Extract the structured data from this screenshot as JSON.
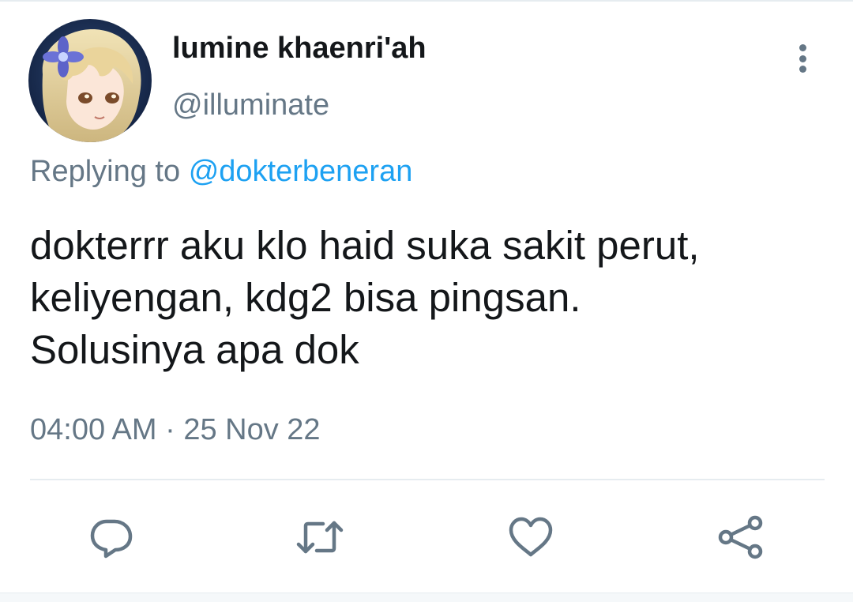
{
  "tweet": {
    "author": {
      "display_name": "lumine khaenri'ah",
      "handle": "@illuminate",
      "avatar_icon": "avatar-image"
    },
    "reply": {
      "prefix": "Replying to",
      "mention": "@dokterbeneran"
    },
    "text_lines": [
      "dokterrr aku klo haid suka sakit perut,",
      "keliyengan, kdg2 bisa pingsan.",
      "Solusinya apa dok"
    ],
    "timestamp": "04:00 AM · 25 Nov 22",
    "actions": [
      "reply-icon",
      "retweet-icon",
      "like-icon",
      "share-icon"
    ]
  },
  "colors": {
    "text": "#14171a",
    "secondary": "#657786",
    "link": "#1da1f2",
    "divider": "#e6ecf0"
  }
}
